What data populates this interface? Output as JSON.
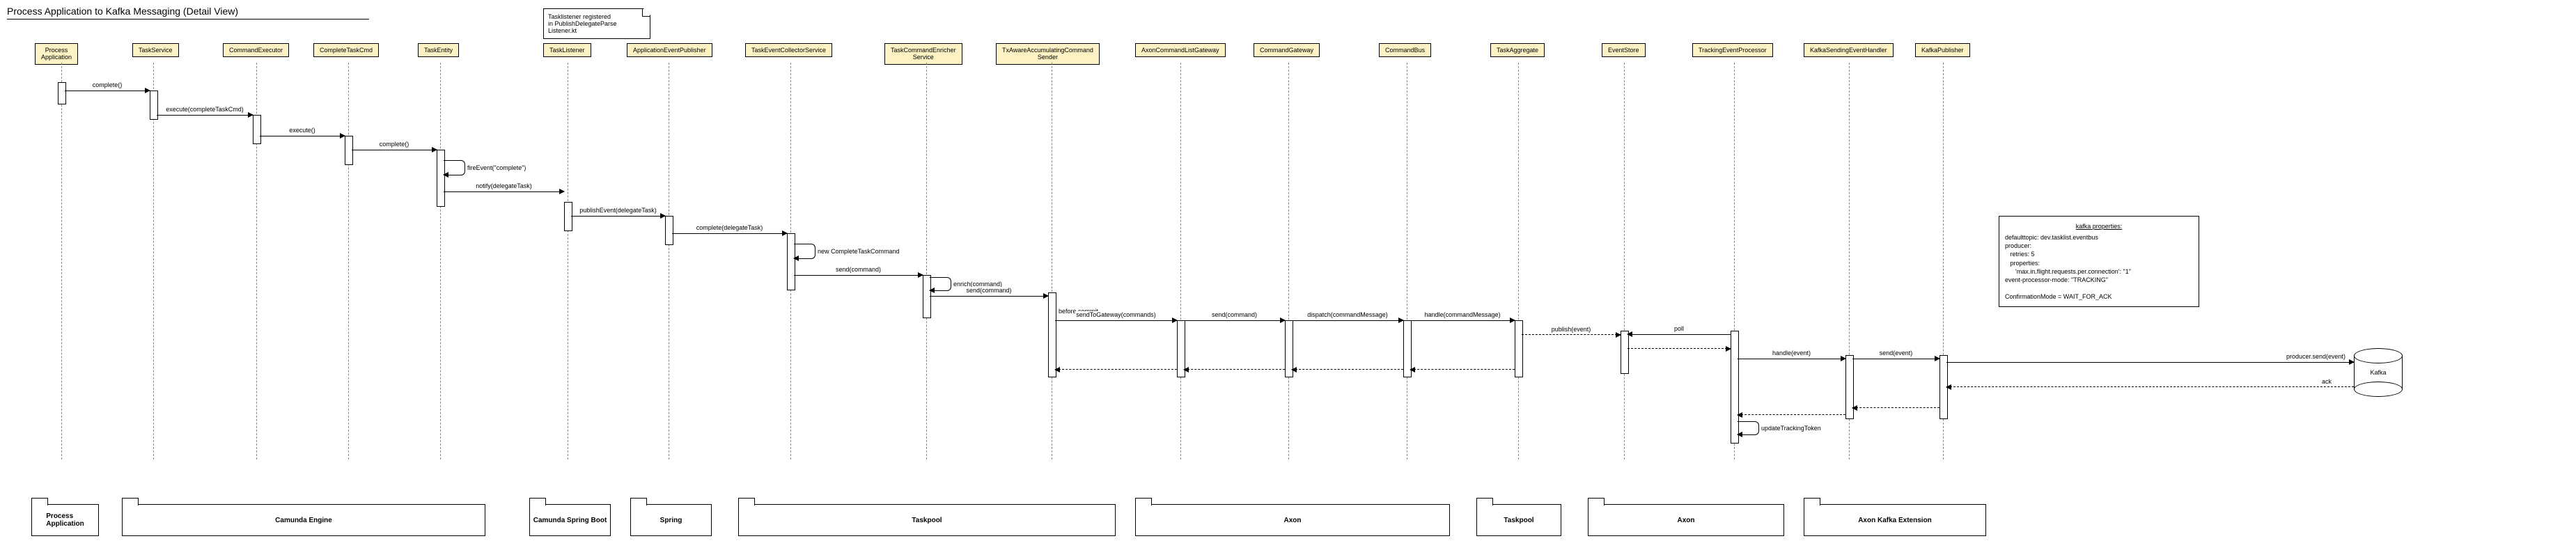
{
  "title": "Process Application to Kafka Messaging (Detail View)",
  "listenerNote": "Tasklistener registered\nin PublishDelegateParse\nListener.kt",
  "kafkaNoteTitle": "kafka properties:",
  "kafkaNote": "defaulttopic: dev.tasklist.eventbus\nproducer:\n   retries: 5\n   properties:\n      'max.in.flight.requests.per.connection': \"1\"\nevent-processor-mode: \"TRACKING\"\n\nConfirmationMode = WAIT_FOR_ACK",
  "kafkaCylinder": "Kafka",
  "participants": {
    "p0": "Process\nApplication",
    "p1": "TaskService",
    "p2": "CommandExecutor",
    "p3": "CompleteTaskCmd",
    "p4": "TaskEntity",
    "p5": "TaskListener",
    "p6": "ApplicationEventPublisher",
    "p7": "TaskEventCollectorService",
    "p8": "TaskCommandEnricher\nService",
    "p9": "TxAwareAccumulatingCommand\nSender",
    "p10": "AxonCommandListGateway",
    "p11": "CommandGateway",
    "p12": "CommandBus",
    "p13": "TaskAggregate",
    "p14": "EventStore",
    "p15": "TrackingEventProcessor",
    "p16": "KafkaSendingEventHandler",
    "p17": "KafkaPublisher"
  },
  "messages": {
    "m0": "complete()",
    "m1": "execute(completeTaskCmd)",
    "m2": "execute()",
    "m3": "complete()",
    "m4": "fireEvent(\"complete\")",
    "m5": "notify(delegateTask)",
    "m6": "publishEvent(delegateTask)",
    "m7": "complete(delegateTask)",
    "m8": "new CompleteTaskCommand",
    "m9": "send(command)",
    "m10": "enrich(command)",
    "m11": "send(command)",
    "m12": "before commit",
    "m13": "sendToGateway(commands)",
    "m14": "send(command)",
    "m15": "dispatch(commandMessage)",
    "m16": "handle(commandMessage)",
    "m17": "publish(event)",
    "m18": "poll",
    "m19": "handle(event)",
    "m20": "send(event)",
    "m21": "producer.send(event)",
    "m22": "ack",
    "m23": "updateTrackingToken"
  },
  "packages": {
    "pk0": "Process\nApplication",
    "pk1": "Camunda Engine",
    "pk2": "Camunda Spring Boot",
    "pk3": "Spring",
    "pk4": "Taskpool",
    "pk5": "Axon",
    "pk6": "Taskpool",
    "pk7": "Axon",
    "pk8": "Axon Kafka Extension"
  },
  "chart_data": {
    "type": "sequence-diagram",
    "participants": [
      "Process Application",
      "TaskService",
      "CommandExecutor",
      "CompleteTaskCmd",
      "TaskEntity",
      "TaskListener",
      "ApplicationEventPublisher",
      "TaskEventCollectorService",
      "TaskCommandEnricherService",
      "TxAwareAccumulatingCommandSender",
      "AxonCommandListGateway",
      "CommandGateway",
      "CommandBus",
      "TaskAggregate",
      "EventStore",
      "TrackingEventProcessor",
      "KafkaSendingEventHandler",
      "KafkaPublisher",
      "Kafka"
    ],
    "groups": [
      {
        "name": "Process Application",
        "members": [
          "Process Application"
        ]
      },
      {
        "name": "Camunda Engine",
        "members": [
          "TaskService",
          "CommandExecutor",
          "CompleteTaskCmd",
          "TaskEntity"
        ]
      },
      {
        "name": "Camunda Spring Boot",
        "members": [
          "TaskListener"
        ]
      },
      {
        "name": "Spring",
        "members": [
          "ApplicationEventPublisher"
        ]
      },
      {
        "name": "Taskpool",
        "members": [
          "TaskEventCollectorService",
          "TaskCommandEnricherService",
          "TxAwareAccumulatingCommandSender"
        ]
      },
      {
        "name": "Axon",
        "members": [
          "AxonCommandListGateway",
          "CommandGateway",
          "CommandBus"
        ]
      },
      {
        "name": "Taskpool",
        "members": [
          "TaskAggregate"
        ]
      },
      {
        "name": "Axon",
        "members": [
          "EventStore",
          "TrackingEventProcessor"
        ]
      },
      {
        "name": "Axon Kafka Extension",
        "members": [
          "KafkaSendingEventHandler",
          "KafkaPublisher"
        ]
      }
    ],
    "messages": [
      {
        "from": "Process Application",
        "to": "TaskService",
        "label": "complete()",
        "kind": "sync"
      },
      {
        "from": "TaskService",
        "to": "CommandExecutor",
        "label": "execute(completeTaskCmd)",
        "kind": "sync"
      },
      {
        "from": "CommandExecutor",
        "to": "CompleteTaskCmd",
        "label": "execute()",
        "kind": "sync"
      },
      {
        "from": "CompleteTaskCmd",
        "to": "TaskEntity",
        "label": "complete()",
        "kind": "sync"
      },
      {
        "from": "TaskEntity",
        "to": "TaskEntity",
        "label": "fireEvent(\"complete\")",
        "kind": "self"
      },
      {
        "from": "TaskEntity",
        "to": "TaskListener",
        "label": "notify(delegateTask)",
        "kind": "sync"
      },
      {
        "from": "TaskListener",
        "to": "ApplicationEventPublisher",
        "label": "publishEvent(delegateTask)",
        "kind": "sync"
      },
      {
        "from": "ApplicationEventPublisher",
        "to": "TaskEventCollectorService",
        "label": "complete(delegateTask)",
        "kind": "sync"
      },
      {
        "from": "TaskEventCollectorService",
        "to": "TaskEventCollectorService",
        "label": "new CompleteTaskCommand",
        "kind": "self"
      },
      {
        "from": "TaskEventCollectorService",
        "to": "TaskCommandEnricherService",
        "label": "send(command)",
        "kind": "sync"
      },
      {
        "from": "TaskCommandEnricherService",
        "to": "TaskCommandEnricherService",
        "label": "enrich(command)",
        "kind": "self"
      },
      {
        "from": "TaskCommandEnricherService",
        "to": "TxAwareAccumulatingCommandSender",
        "label": "send(command)",
        "kind": "sync"
      },
      {
        "from": "TxAwareAccumulatingCommandSender",
        "to": "TxAwareAccumulatingCommandSender",
        "label": "before commit",
        "kind": "note"
      },
      {
        "from": "TxAwareAccumulatingCommandSender",
        "to": "AxonCommandListGateway",
        "label": "sendToGateway(commands)",
        "kind": "sync"
      },
      {
        "from": "AxonCommandListGateway",
        "to": "CommandGateway",
        "label": "send(command)",
        "kind": "sync"
      },
      {
        "from": "CommandGateway",
        "to": "CommandBus",
        "label": "dispatch(commandMessage)",
        "kind": "sync"
      },
      {
        "from": "CommandBus",
        "to": "TaskAggregate",
        "label": "handle(commandMessage)",
        "kind": "sync"
      },
      {
        "from": "TaskAggregate",
        "to": "EventStore",
        "label": "publish(event)",
        "kind": "async-dashed"
      },
      {
        "from": "TrackingEventProcessor",
        "to": "EventStore",
        "label": "poll",
        "kind": "sync"
      },
      {
        "from": "EventStore",
        "to": "TrackingEventProcessor",
        "label": "",
        "kind": "return"
      },
      {
        "from": "TrackingEventProcessor",
        "to": "KafkaSendingEventHandler",
        "label": "handle(event)",
        "kind": "sync"
      },
      {
        "from": "KafkaSendingEventHandler",
        "to": "KafkaPublisher",
        "label": "send(event)",
        "kind": "sync"
      },
      {
        "from": "KafkaPublisher",
        "to": "Kafka",
        "label": "producer.send(event)",
        "kind": "sync"
      },
      {
        "from": "Kafka",
        "to": "KafkaPublisher",
        "label": "ack",
        "kind": "return"
      },
      {
        "from": "KafkaPublisher",
        "to": "KafkaSendingEventHandler",
        "label": "",
        "kind": "return"
      },
      {
        "from": "KafkaSendingEventHandler",
        "to": "TrackingEventProcessor",
        "label": "",
        "kind": "return"
      },
      {
        "from": "TrackingEventProcessor",
        "to": "TrackingEventProcessor",
        "label": "updateTrackingToken",
        "kind": "self"
      },
      {
        "from": "TaskAggregate",
        "to": "CommandBus",
        "label": "",
        "kind": "return"
      },
      {
        "from": "CommandBus",
        "to": "CommandGateway",
        "label": "",
        "kind": "return"
      },
      {
        "from": "CommandGateway",
        "to": "AxonCommandListGateway",
        "label": "",
        "kind": "return"
      },
      {
        "from": "AxonCommandListGateway",
        "to": "TxAwareAccumulatingCommandSender",
        "label": "",
        "kind": "return"
      }
    ],
    "notes": [
      {
        "attached": "TaskListener",
        "text": "Tasklistener registered in PublishDelegateParseListener.kt"
      },
      {
        "attached": "KafkaPublisher",
        "text": "kafka properties:\ndefaulttopic: dev.tasklist.eventbus\nproducer:\n  retries: 5\n  properties:\n    'max.in.flight.requests.per.connection': \"1\"\nevent-processor-mode: \"TRACKING\"\n\nConfirmationMode = WAIT_FOR_ACK"
      }
    ]
  }
}
